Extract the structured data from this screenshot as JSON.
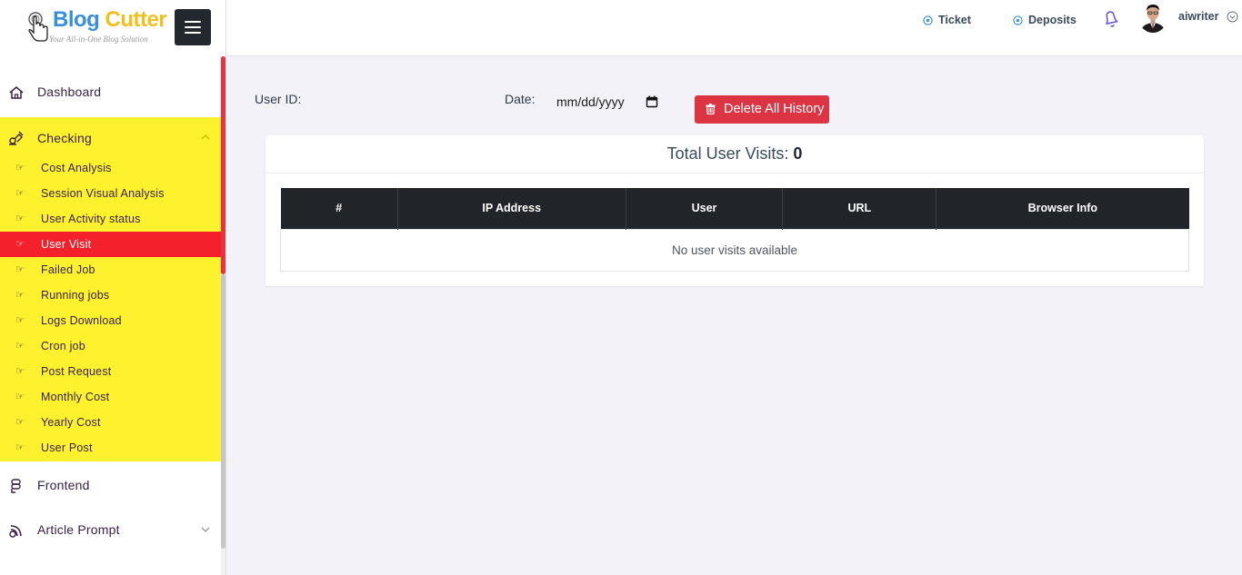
{
  "brand": {
    "name_part1": "Blog",
    "name_part2": "Cutter",
    "tagline": "Your All-in-One Blog Solution"
  },
  "sidebar": {
    "items": [
      {
        "label": "Dashboard",
        "icon": "home-icon"
      },
      {
        "label": "Checking",
        "icon": "checking-icon",
        "expanded": true,
        "children": [
          {
            "label": "Cost Analysis"
          },
          {
            "label": "Session Visual Analysis"
          },
          {
            "label": "User Activity status"
          },
          {
            "label": "User Visit",
            "active": true
          },
          {
            "label": "Failed Job"
          },
          {
            "label": "Running jobs"
          },
          {
            "label": "Logs Download"
          },
          {
            "label": "Cron job"
          },
          {
            "label": "Post Request"
          },
          {
            "label": "Monthly Cost"
          },
          {
            "label": "Yearly Cost"
          },
          {
            "label": "User Post"
          }
        ]
      },
      {
        "label": "Frontend",
        "icon": "frontend-icon"
      },
      {
        "label": "Article Prompt",
        "icon": "article-prompt-icon"
      }
    ],
    "submenu_icon": "hand-pointer-icon",
    "hand_glyph": "☞"
  },
  "topbar": {
    "ticket_label": "Ticket",
    "deposits_label": "Deposits",
    "username": "aiwriter"
  },
  "filters": {
    "user_id_label": "User ID:",
    "date_label": "Date:",
    "date_placeholder": "mm/dd/yyyy",
    "delete_button_label": "Delete All History"
  },
  "visits": {
    "title_label": "Total User Visits:",
    "total": "0",
    "columns": [
      "#",
      "IP Address",
      "User",
      "URL",
      "Browser Info"
    ],
    "empty_message": "No user visits available"
  },
  "colors": {
    "sidebar_highlight": "#fef22e",
    "active_item": "#f4212c",
    "delete_button": "#dc3442",
    "table_header": "#212529",
    "brand_blue": "#3a8fd8",
    "brand_yellow": "#f2c01e",
    "accent_icon": "#3a8fd8",
    "bell": "#6b5bd6"
  }
}
